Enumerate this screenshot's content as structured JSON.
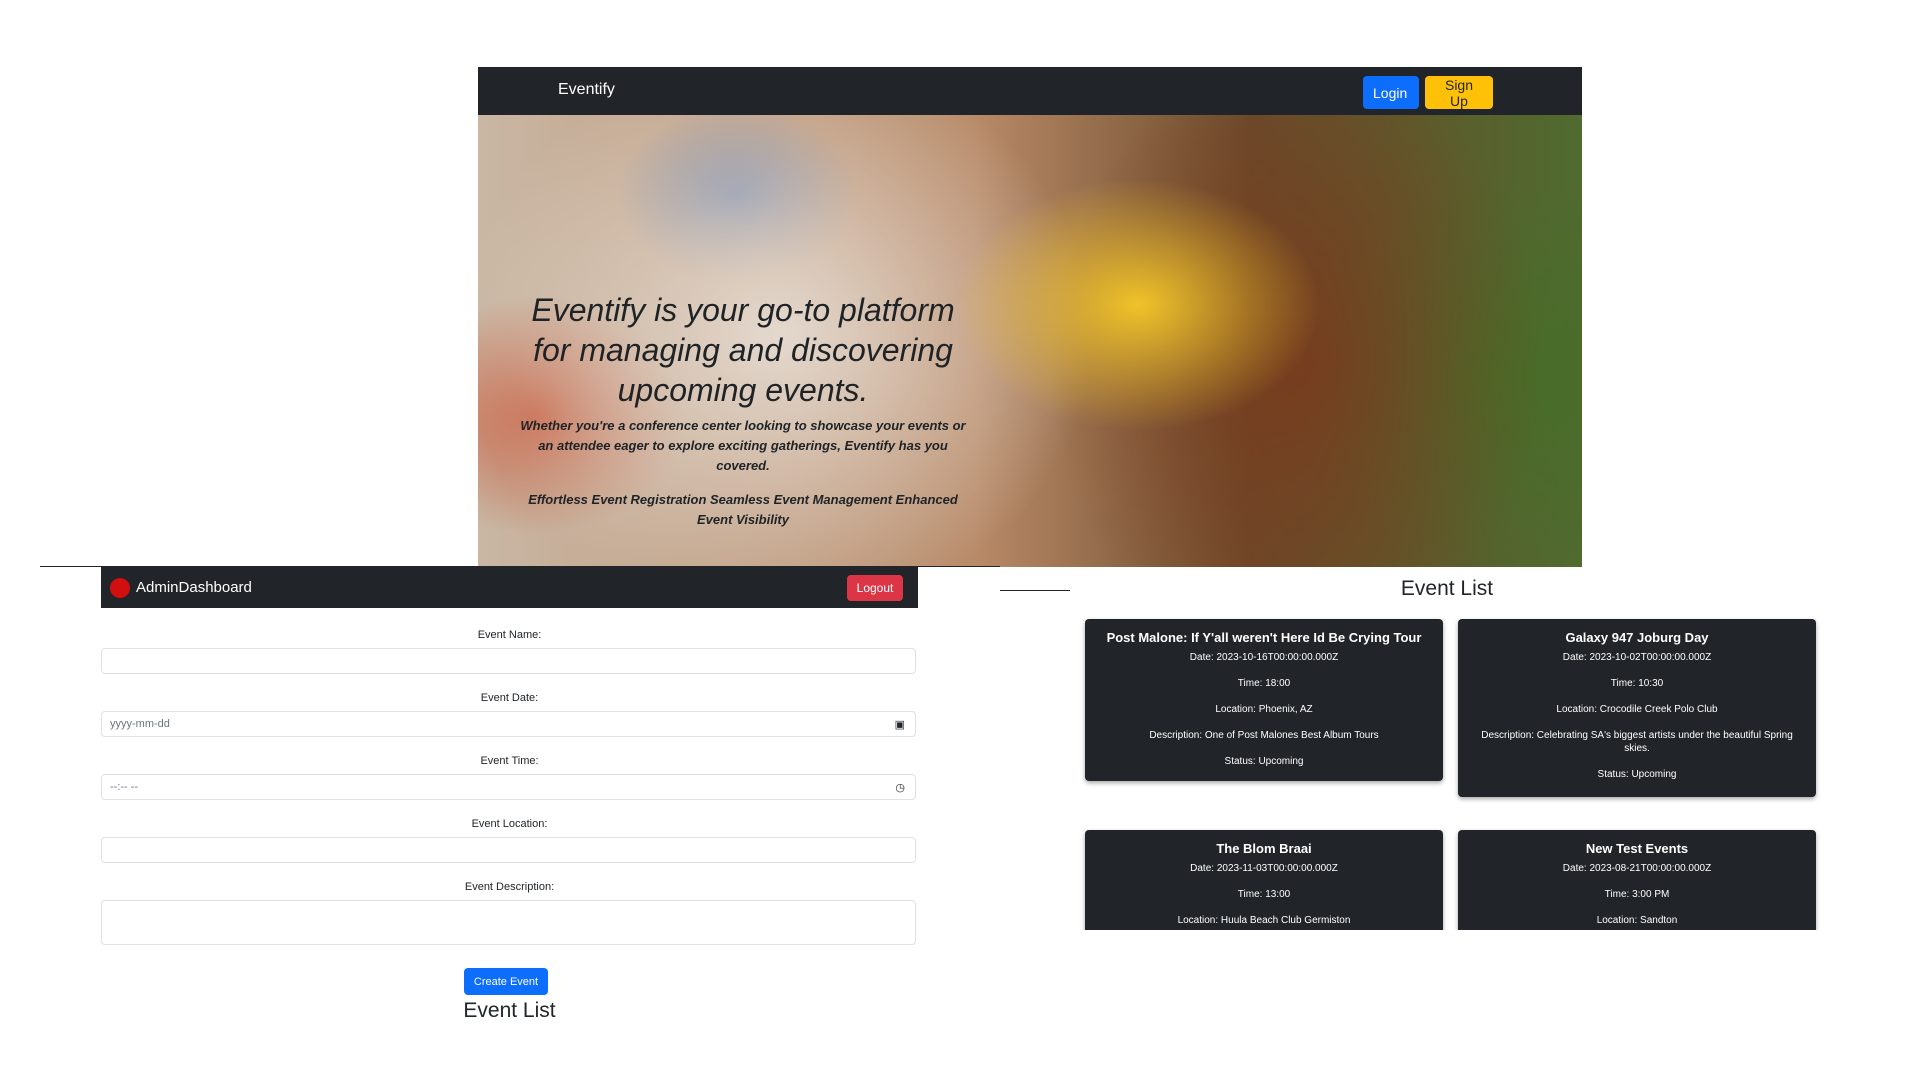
{
  "landing": {
    "brand": "Eventify",
    "login_label": "Login",
    "signup_label": "Sign Up",
    "hero_title": "Eventify is your go-to platform for managing and discovering upcoming events.",
    "hero_subtitle": "Whether you're a conference center looking to showcase your events or an attendee eager to explore exciting gatherings, Eventify has you covered.",
    "hero_features": "Effortless Event Registration Seamless Event Management Enhanced Event Visibility"
  },
  "admin": {
    "title": "AdminDashboard",
    "logout_label": "Logout",
    "fields": {
      "name_label": "Event Name:",
      "name_value": "",
      "date_label": "Event Date:",
      "date_placeholder": "yyyy-mm-dd",
      "time_label": "Event Time:",
      "time_placeholder": "--:-- --",
      "location_label": "Event Location:",
      "location_value": "",
      "description_label": "Event Description:",
      "description_value": ""
    },
    "create_label": "Create Event",
    "list_title": "Event List"
  },
  "events": {
    "title": "Event List",
    "items": [
      {
        "name": "Post Malone: If Y'all weren't Here Id Be Crying Tour",
        "date": "Date: 2023-10-16T00:00:00.000Z",
        "time": "Time: 18:00",
        "location": "Location: Phoenix, AZ",
        "description": "Description: One of Post Malones Best Album Tours",
        "status": "Status: Upcoming"
      },
      {
        "name": "Galaxy 947 Joburg Day",
        "date": "Date: 2023-10-02T00:00:00.000Z",
        "time": "Time: 10:30",
        "location": "Location: Crocodile Creek Polo Club",
        "description": "Description: Celebrating SA's biggest artists under the beautiful Spring skies.",
        "status": "Status: Upcoming"
      },
      {
        "name": "The Blom Braai",
        "date": "Date: 2023-11-03T00:00:00.000Z",
        "time": "Time: 13:00",
        "location": "Location: Huula Beach Club Germiston"
      },
      {
        "name": "New Test Events",
        "date": "Date: 2023-08-21T00:00:00.000Z",
        "time": "Time: 3:00 PM",
        "location": "Location: Sandton"
      }
    ]
  }
}
